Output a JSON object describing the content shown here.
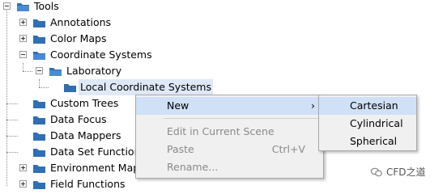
{
  "tree": {
    "root": "Tools",
    "items": [
      {
        "label": "Annotations",
        "state": "collapsed"
      },
      {
        "label": "Color Maps",
        "state": "collapsed"
      },
      {
        "label": "Coordinate Systems",
        "state": "expanded"
      },
      {
        "label": "Laboratory",
        "state": "expanded"
      },
      {
        "label": "Local Coordinate Systems",
        "state": "selected"
      },
      {
        "label": "Custom Trees",
        "state": "leaf"
      },
      {
        "label": "Data Focus",
        "state": "leaf"
      },
      {
        "label": "Data Mappers",
        "state": "leaf"
      },
      {
        "label": "Data Set Functions",
        "state": "leaf"
      },
      {
        "label": "Environment Maps",
        "state": "collapsed"
      },
      {
        "label": "Field Functions",
        "state": "collapsed"
      }
    ]
  },
  "context_menu": {
    "new": "New",
    "edit_in_scene": "Edit in Current Scene",
    "paste": "Paste",
    "paste_shortcut": "Ctrl+V",
    "rename": "Rename...",
    "arrow": "›"
  },
  "submenu": {
    "items": [
      "Cartesian",
      "Cylindrical",
      "Spherical"
    ]
  },
  "watermark": {
    "text": "CFD之道"
  },
  "colors": {
    "folder": "#2f6fb3",
    "highlight": "#cfe0f7",
    "selected": "#dfe8f6"
  }
}
